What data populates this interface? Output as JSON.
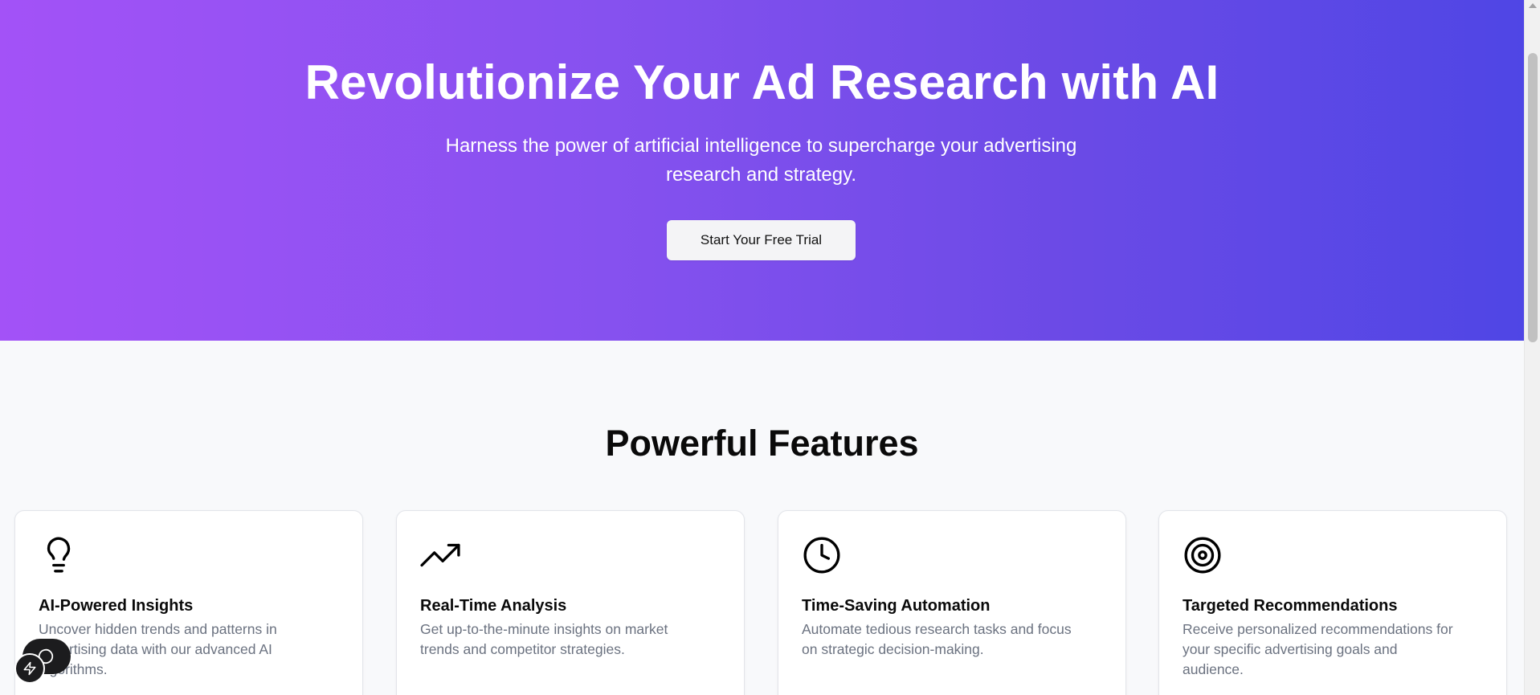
{
  "hero": {
    "title": "Revolutionize Your Ad Research with AI",
    "subtitle": "Harness the power of artificial intelligence to supercharge your advertising research and strategy.",
    "cta_label": "Start Your Free Trial",
    "gradient_start": "#a352f7",
    "gradient_end": "#4f46e5"
  },
  "features": {
    "heading": "Powerful Features",
    "cards": [
      {
        "icon": "lightbulb-icon",
        "title": "AI-Powered Insights",
        "description": "Uncover hidden trends and patterns in advertising data with our advanced AI algorithms."
      },
      {
        "icon": "trending-up-icon",
        "title": "Real-Time Analysis",
        "description": "Get up-to-the-minute insights on market trends and competitor strategies."
      },
      {
        "icon": "clock-icon",
        "title": "Time-Saving Automation",
        "description": "Automate tedious research tasks and focus on strategic decision-making."
      },
      {
        "icon": "target-icon",
        "title": "Targeted Recommendations",
        "description": "Receive personalized recommendations for your specific advertising goals and audience."
      }
    ]
  },
  "widgets": {
    "chat_icon": "chat-bubble-icon",
    "bolt_icon": "lightning-bolt-icon"
  }
}
